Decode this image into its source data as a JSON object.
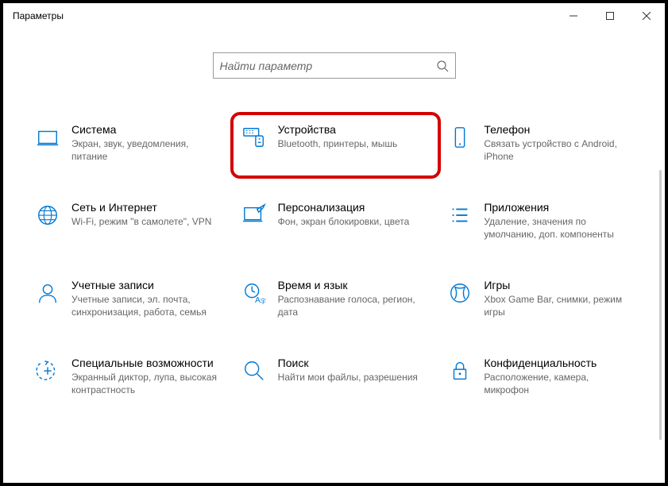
{
  "window": {
    "title": "Параметры"
  },
  "search": {
    "placeholder": "Найти параметр"
  },
  "cards": {
    "system": {
      "title": "Система",
      "desc": "Экран, звук, уведомления, питание"
    },
    "devices": {
      "title": "Устройства",
      "desc": "Bluetooth, принтеры, мышь"
    },
    "phone": {
      "title": "Телефон",
      "desc": "Связать устройство с Android, iPhone"
    },
    "network": {
      "title": "Сеть и Интернет",
      "desc": "Wi-Fi, режим \"в самолете\", VPN"
    },
    "personal": {
      "title": "Персонализация",
      "desc": "Фон, экран блокировки, цвета"
    },
    "apps": {
      "title": "Приложения",
      "desc": "Удаление, значения по умолчанию, доп. компоненты"
    },
    "accounts": {
      "title": "Учетные записи",
      "desc": "Учетные записи, эл. почта, синхронизация, работа, семья"
    },
    "time": {
      "title": "Время и язык",
      "desc": "Распознавание голоса, регион, дата"
    },
    "gaming": {
      "title": "Игры",
      "desc": "Xbox Game Bar, снимки, режим игры"
    },
    "ease": {
      "title": "Специальные возможности",
      "desc": "Экранный диктор, лупа, высокая контрастность"
    },
    "searchcat": {
      "title": "Поиск",
      "desc": "Найти мои файлы, разрешения"
    },
    "privacy": {
      "title": "Конфиденциальность",
      "desc": "Расположение, камера, микрофон"
    }
  }
}
